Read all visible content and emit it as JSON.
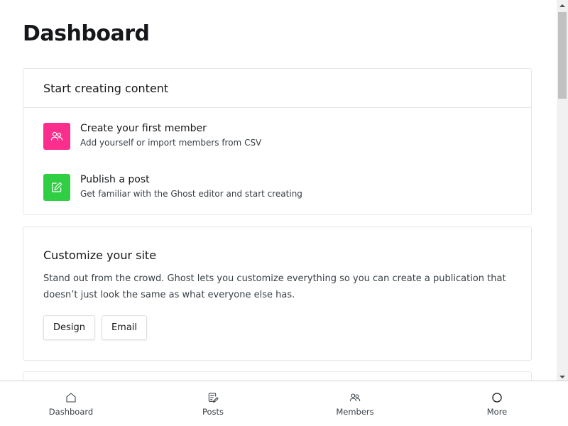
{
  "page": {
    "title": "Dashboard"
  },
  "start_card": {
    "title": "Start creating content",
    "items": [
      {
        "title": "Create your first member",
        "subtitle": "Add yourself or import members from CSV",
        "icon": "members-icon",
        "color": "#fb2d8d"
      },
      {
        "title": "Publish a post",
        "subtitle": "Get familiar with the Ghost editor and start creating",
        "icon": "edit-icon",
        "color": "#30cf43"
      }
    ]
  },
  "customize_card": {
    "title": "Customize your site",
    "description": "Stand out from the crowd. Ghost lets you customize everything so you can create a publication that doesn’t just look the same as what everyone else has.",
    "buttons": {
      "design": "Design",
      "email": "Email"
    }
  },
  "bottom_nav": {
    "items": [
      {
        "label": "Dashboard",
        "icon": "home-icon"
      },
      {
        "label": "Posts",
        "icon": "posts-icon"
      },
      {
        "label": "Members",
        "icon": "members-icon"
      },
      {
        "label": "More",
        "icon": "circle-icon"
      }
    ]
  }
}
